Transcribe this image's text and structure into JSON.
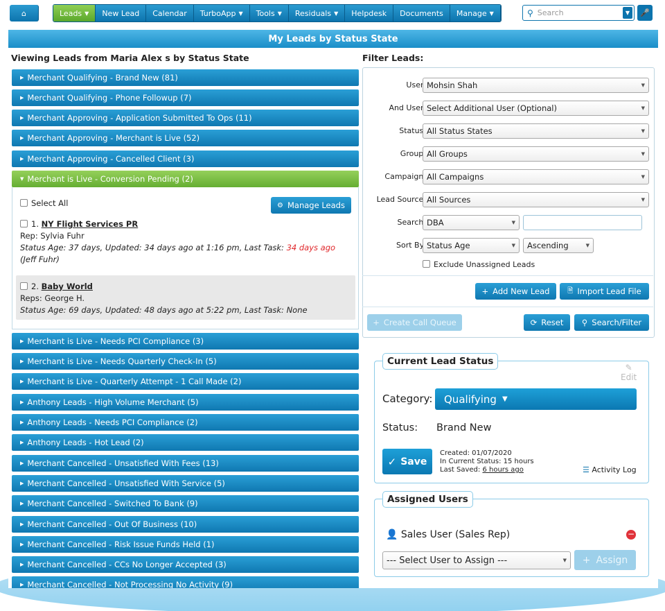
{
  "nav": {
    "home_icon": "home-icon",
    "items": [
      "Leads",
      "New Lead",
      "Calendar",
      "TurboApp",
      "Tools",
      "Residuals",
      "Helpdesk",
      "Documents",
      "Manage"
    ],
    "search_placeholder": "Search",
    "caret": "▾"
  },
  "page_title": "My Leads by Status State",
  "left": {
    "heading": "Viewing Leads from Maria Alex s by Status State",
    "groups_top": [
      "Merchant Qualifying - Brand New (81)",
      "Merchant Qualifying - Phone Followup (7)",
      "Merchant Approving - Application Submitted To Ops (11)",
      "Merchant Approving - Merchant is Live (52)",
      "Merchant Approving - Cancelled Client (3)"
    ],
    "open_group": "Merchant is Live - Conversion Pending (2)",
    "select_all": "Select All",
    "manage_leads": "Manage Leads",
    "leads": [
      {
        "num": "1.",
        "name": "NY Flight Services PR",
        "rep": "Rep: Sylvia Fuhr",
        "status": "Status Age: 37 days, Updated: 34 days ago at 1:16 pm, Last Task:",
        "last_task": "34 days ago",
        "by": "(Jeff Fuhr)"
      },
      {
        "num": "2.",
        "name": "Baby World",
        "rep": "Reps: George H.",
        "status": "Status Age: 69 days, Updated: 48 days ago at 5:22 pm, Last Task: None",
        "last_task": "",
        "by": ""
      }
    ],
    "groups_bottom": [
      "Merchant is Live - Needs PCI Compliance (3)",
      "Merchant is Live - Needs Quarterly Check-In (5)",
      "Merchant is Live - Quarterly Attempt - 1 Call Made (2)",
      "Anthony Leads - High Volume Merchant (5)",
      "Anthony Leads - Needs PCI Compliance (2)",
      "Anthony Leads - Hot Lead (2)",
      "Merchant Cancelled - Unsatisfied With Fees (13)",
      "Merchant Cancelled - Unsatisfied With Service (5)",
      "Merchant Cancelled - Switched To Bank (9)",
      "Merchant Cancelled - Out Of Business (10)",
      "Merchant Cancelled - Risk Issue Funds Held (1)",
      "Merchant Cancelled - CCs No Longer Accepted (3)",
      "Merchant Cancelled - Not Processing No Activity (9)"
    ]
  },
  "filter": {
    "heading": "Filter Leads:",
    "user_label": "User:",
    "user_value": "Mohsin Shah",
    "and_user_label": "And User:",
    "and_user_value": "Select Additional User (Optional)",
    "status_label": "Status:",
    "status_value": "All Status States",
    "group_label": "Group:",
    "group_value": "All Groups",
    "campaign_label": "Campaign:",
    "campaign_value": "All Campaigns",
    "lead_source_label": "Lead Source:",
    "lead_source_value": "All Sources",
    "search_label": "Search:",
    "search_field": "DBA",
    "search_text": "",
    "sort_label": "Sort By:",
    "sort_value": "Status Age",
    "sort_order": "Ascending",
    "exclude_label": "Exclude Unassigned Leads",
    "add_lead": "Add New Lead",
    "import_lead": "Import Lead File",
    "create_queue": "Create Call Queue",
    "reset": "Reset",
    "search_filter": "Search/Filter"
  },
  "status_panel": {
    "legend": "Current Lead Status",
    "edit": "Edit",
    "category_label": "Category:",
    "category_value": "Qualifying",
    "status_label": "Status:",
    "status_value": "Brand New",
    "save": "Save",
    "created": "Created: 01/07/2020",
    "in_status": "In Current Status: 15 hours",
    "last_saved_label": "Last Saved:",
    "last_saved_value": "6 hours ago",
    "activity_log": "Activity Log"
  },
  "assigned": {
    "legend": "Assigned Users",
    "user": "Sales User (Sales Rep)",
    "select_placeholder": "--- Select User to Assign ---",
    "assign": "Assign"
  }
}
